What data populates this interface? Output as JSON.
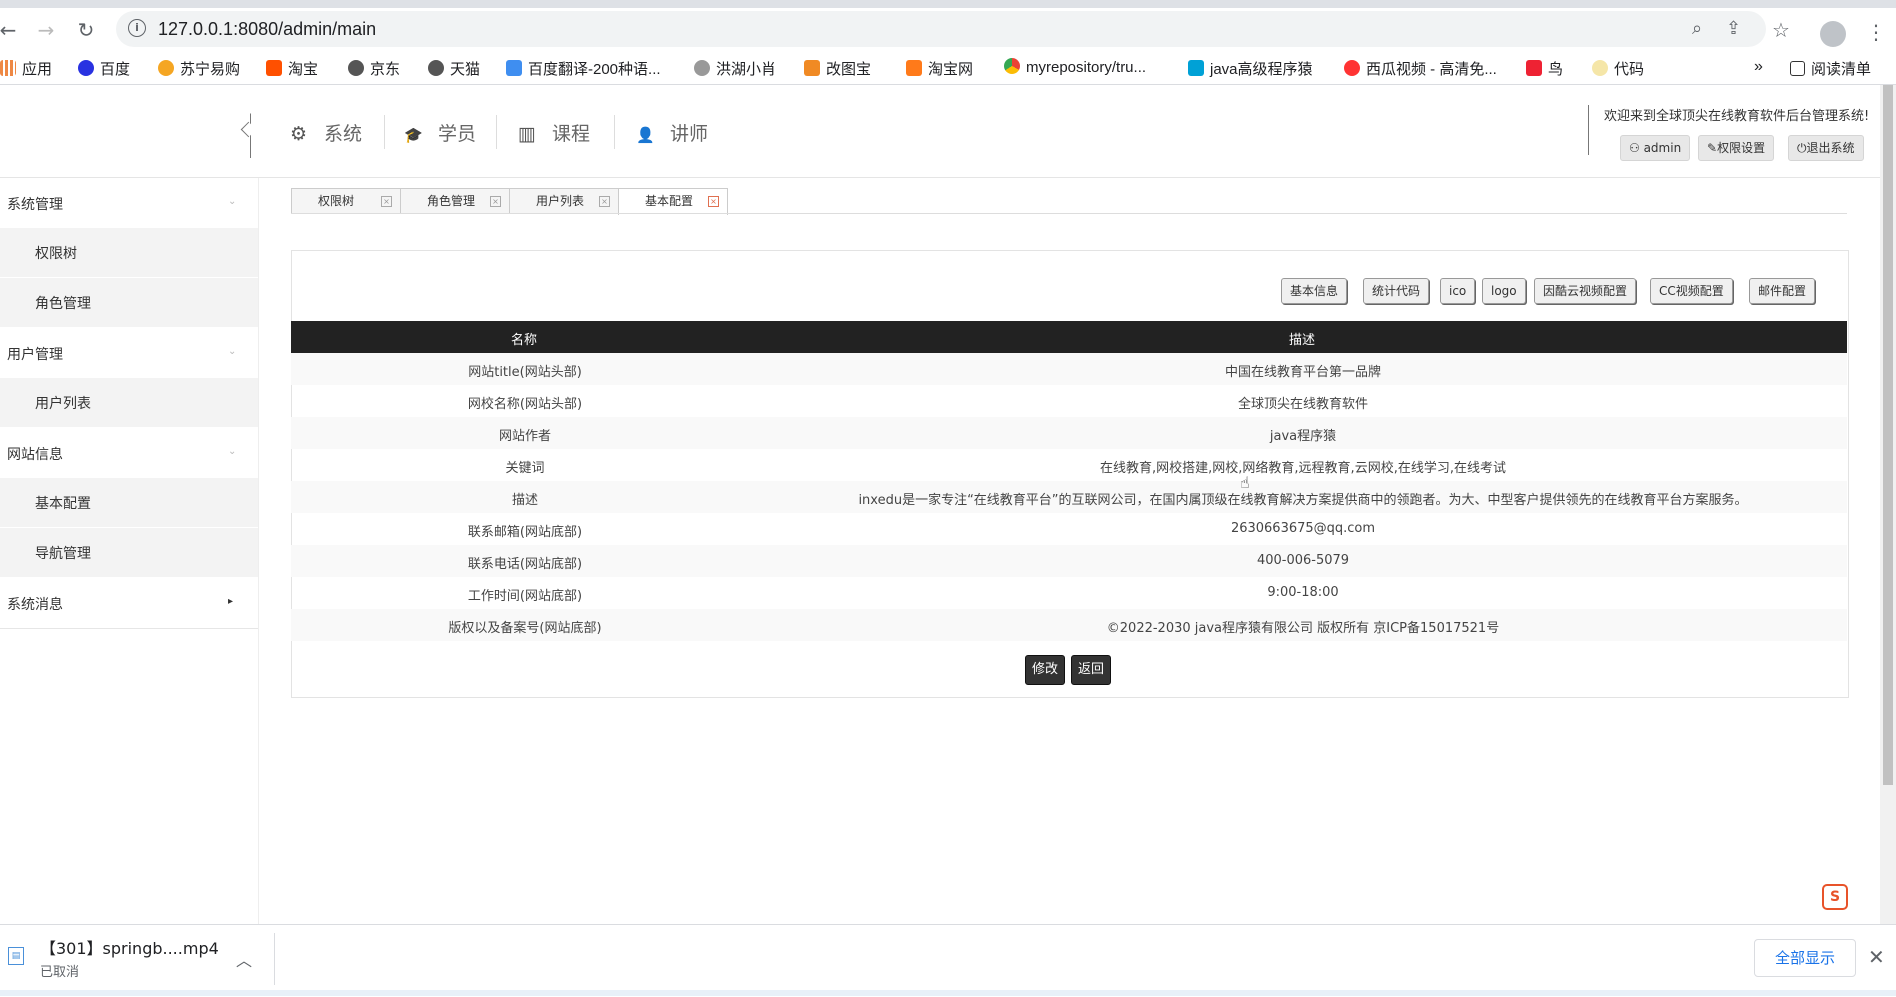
{
  "browser": {
    "url": "127.0.0.1:8080/admin/main",
    "bookmarks": [
      "应用",
      "百度",
      "苏宁易购",
      "淘宝",
      "京东",
      "天猫",
      "百度翻译-200种语...",
      "洪湖小肖",
      "改图宝",
      "淘宝网",
      "myrepository/tru...",
      "java高级程序猿",
      "西瓜视频 - 高清免...",
      "鸟",
      "代码"
    ],
    "more_bookmarks": "»",
    "reading_list": "阅读清单"
  },
  "header": {
    "menu": [
      {
        "label": "系统",
        "icon": "gear-icon",
        "glyph": "⚙"
      },
      {
        "label": "学员",
        "icon": "graduation-cap-icon",
        "glyph": "🎓"
      },
      {
        "label": "课程",
        "icon": "bar-chart-icon",
        "glyph": "▥"
      },
      {
        "label": "讲师",
        "icon": "user-icon",
        "glyph": "👤"
      }
    ],
    "welcome": "欢迎来到全球顶尖在线教育软件后台管理系统!",
    "buttons": [
      "admin",
      "权限设置",
      "退出系统"
    ]
  },
  "sidebar": {
    "groups": [
      {
        "label": "系统管理",
        "items": [
          "权限树",
          "角色管理"
        ]
      },
      {
        "label": "用户管理",
        "items": [
          "用户列表"
        ]
      },
      {
        "label": "网站信息",
        "items": [
          "基本配置",
          "导航管理"
        ]
      },
      {
        "label": "系统消息",
        "items": []
      }
    ]
  },
  "tabs": [
    "权限树",
    "角色管理",
    "用户列表",
    "基本配置"
  ],
  "config_buttons": [
    "基本信息",
    "统计代码",
    "ico",
    "logo",
    "因酷云视频配置",
    "CC视频配置",
    "邮件配置"
  ],
  "table": {
    "headers": [
      "名称",
      "描述"
    ],
    "rows": [
      [
        "网站title(网站头部)",
        "中国在线教育平台第一品牌"
      ],
      [
        "网校名称(网站头部)",
        "全球顶尖在线教育软件"
      ],
      [
        "网站作者",
        "java程序猿"
      ],
      [
        "关键词",
        "在线教育,网校搭建,网校,网络教育,远程教育,云网校,在线学习,在线考试"
      ],
      [
        "描述",
        "inxedu是一家专注“在线教育平台”的互联网公司，在国内属顶级在线教育解决方案提供商中的领跑者。为大、中型客户提供领先的在线教育平台方案服务。"
      ],
      [
        "联系邮箱(网站底部)",
        "2630663675@qq.com"
      ],
      [
        "联系电话(网站底部)",
        "400-006-5079"
      ],
      [
        "工作时间(网站底部)",
        "9:00-18:00"
      ],
      [
        "版权以及备案号(网站底部)",
        "©2022-2030 java程序猿有限公司 版权所有 京ICP备15017521号"
      ]
    ]
  },
  "actions": {
    "edit": "修改",
    "back": "返回"
  },
  "download": {
    "filename": "【301】springb....mp4",
    "status": "已取消",
    "show_all": "全部显示"
  }
}
